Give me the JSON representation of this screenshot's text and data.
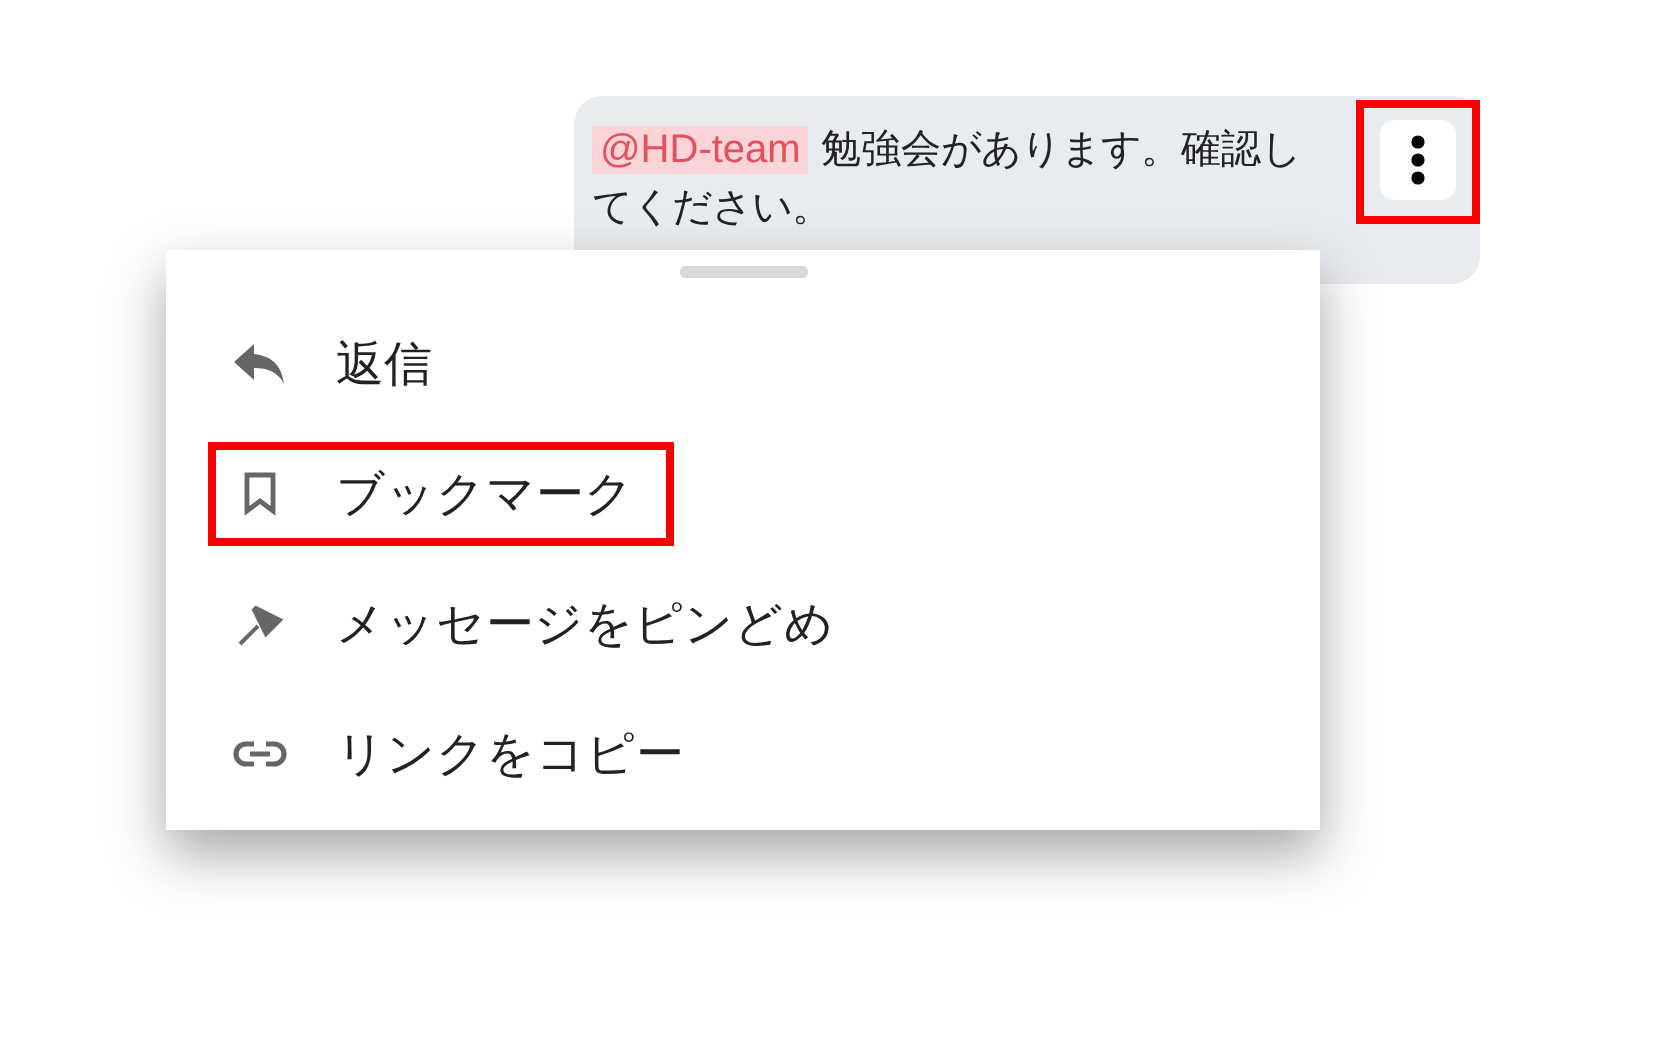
{
  "message": {
    "mention": "@HD-team",
    "text": "勉強会があります。確認してください。",
    "more_button": {
      "highlighted": true
    }
  },
  "menu": {
    "items": [
      {
        "kind": "reply",
        "label": "返信",
        "highlighted": false
      },
      {
        "kind": "bookmark",
        "label": "ブックマーク",
        "highlighted": true
      },
      {
        "kind": "pin",
        "label": "メッセージをピンどめ",
        "highlighted": false
      },
      {
        "kind": "link",
        "label": "リンクをコピー",
        "highlighted": false
      }
    ]
  }
}
